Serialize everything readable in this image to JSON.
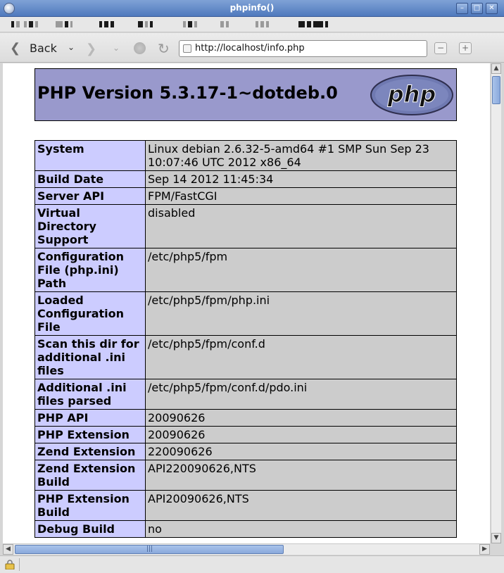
{
  "window": {
    "title": "phpinfo()"
  },
  "nav": {
    "back_label": "Back",
    "url": "http://localhost/info.php"
  },
  "phpinfo": {
    "header": "PHP Version 5.3.17-1~dotdeb.0",
    "logo_text": "php",
    "rows": [
      {
        "key": "System",
        "value": "Linux debian 2.6.32-5-amd64 #1 SMP Sun Sep 23 10:07:46 UTC 2012 x86_64"
      },
      {
        "key": "Build Date",
        "value": "Sep 14 2012 11:45:34"
      },
      {
        "key": "Server API",
        "value": "FPM/FastCGI"
      },
      {
        "key": "Virtual Directory Support",
        "value": "disabled"
      },
      {
        "key": "Configuration File (php.ini) Path",
        "value": "/etc/php5/fpm"
      },
      {
        "key": "Loaded Configuration File",
        "value": "/etc/php5/fpm/php.ini"
      },
      {
        "key": "Scan this dir for additional .ini files",
        "value": "/etc/php5/fpm/conf.d"
      },
      {
        "key": "Additional .ini files parsed",
        "value": "/etc/php5/fpm/conf.d/pdo.ini"
      },
      {
        "key": "PHP API",
        "value": "20090626"
      },
      {
        "key": "PHP Extension",
        "value": "20090626"
      },
      {
        "key": "Zend Extension",
        "value": "220090626"
      },
      {
        "key": "Zend Extension Build",
        "value": "API220090626,NTS"
      },
      {
        "key": "PHP Extension Build",
        "value": "API20090626,NTS"
      },
      {
        "key": "Debug Build",
        "value": "no"
      }
    ]
  },
  "colors": {
    "header_bg": "#9999cc",
    "key_bg": "#ccccff",
    "value_bg": "#cccccc",
    "titlebar": "#5f86c4"
  },
  "icons": {
    "back": "back-arrow-icon",
    "forward": "forward-arrow-icon",
    "stop": "stop-icon",
    "reload": "reload-icon",
    "zoom_out": "zoom-out-icon",
    "zoom_in": "zoom-in-icon",
    "security": "lock-icon"
  }
}
